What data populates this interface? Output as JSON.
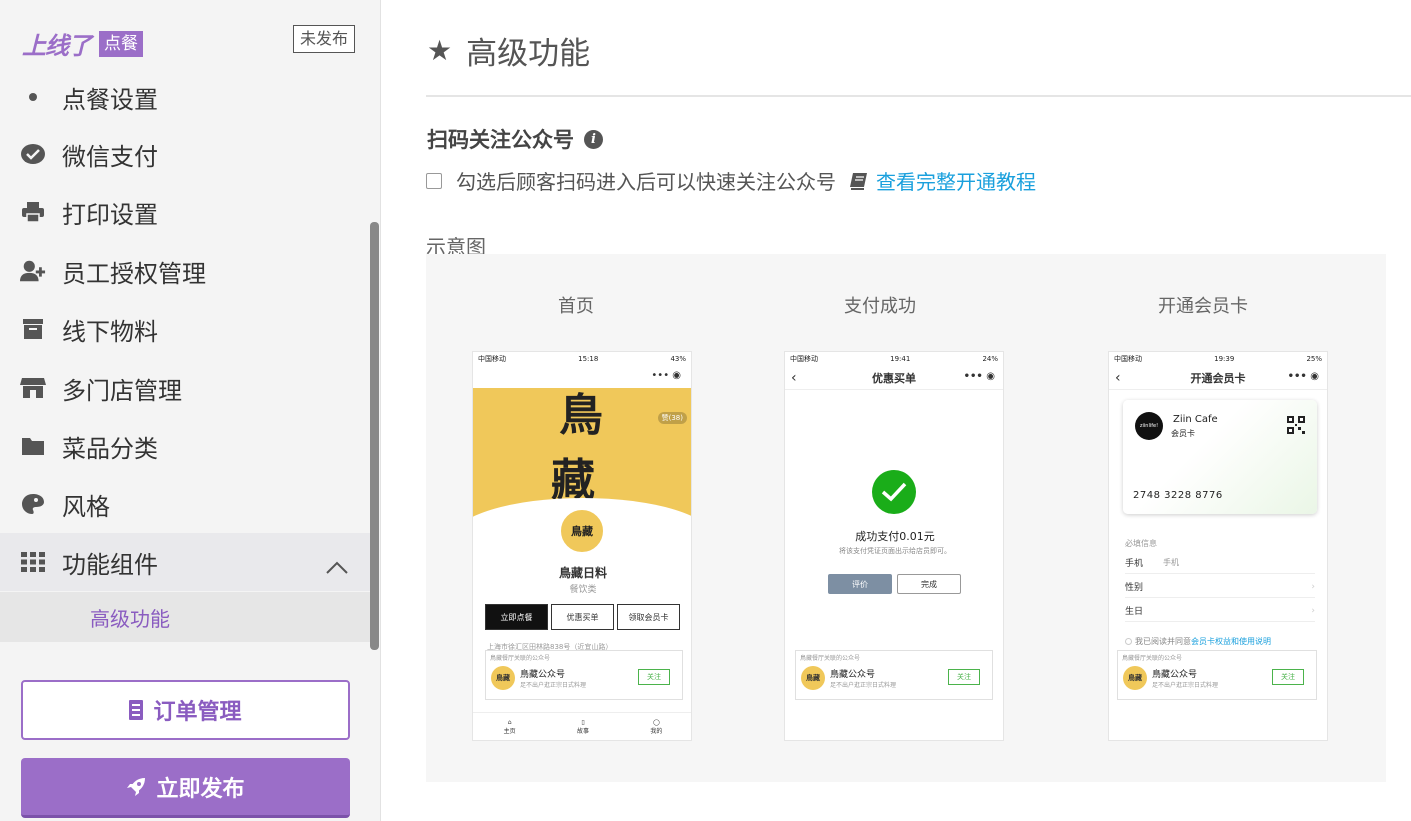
{
  "sidebar": {
    "logo_text": "上线了",
    "logo_badge": "点餐",
    "unpublished": "未发布",
    "partial_item": "点餐设置",
    "items": [
      {
        "label": "微信支付",
        "icon": "wechat-icon"
      },
      {
        "label": "打印设置",
        "icon": "printer-icon"
      },
      {
        "label": "员工授权管理",
        "icon": "user-plus-icon"
      },
      {
        "label": "线下物料",
        "icon": "archive-icon"
      },
      {
        "label": "多门店管理",
        "icon": "store-icon"
      },
      {
        "label": "菜品分类",
        "icon": "folder-icon"
      },
      {
        "label": "风格",
        "icon": "palette-icon"
      },
      {
        "label": "功能组件",
        "icon": "grid-icon"
      }
    ],
    "sub_item": "高级功能",
    "orders_button": "订单管理",
    "publish_button": "立即发布"
  },
  "main": {
    "title": "高级功能",
    "section_title": "扫码关注公众号",
    "checkbox_label": "勾选后顾客扫码进入后可以快速关注公众号",
    "tutorial_link": "查看完整开通教程",
    "demo_label": "示意图",
    "captions": [
      "首页",
      "支付成功",
      "开通会员卡"
    ]
  },
  "phones": {
    "status1": {
      "carrier": "中国移动",
      "time": "15:18",
      "battery": "43%"
    },
    "status2": {
      "carrier": "中国移动",
      "time": "19:41",
      "battery": "24%"
    },
    "status3": {
      "carrier": "中国移动",
      "time": "19:39",
      "battery": "25%"
    },
    "home": {
      "likes": "赞(38)",
      "shop_name": "鳥藏日料",
      "shop_category": "餐饮类",
      "btn_order": "立即点餐",
      "btn_discount": "优惠买单",
      "btn_card": "领取会员卡",
      "address": "上海市徐汇区田林路838号（近宜山路）",
      "tab_home": "主页",
      "tab_story": "故事",
      "tab_mine": "我的"
    },
    "pay": {
      "nav_title": "优惠买单",
      "success_title": "成功支付0.01元",
      "success_sub": "将该支付凭证页面出示给店员即可。",
      "btn_rate": "评价",
      "btn_done": "完成"
    },
    "member": {
      "nav_title": "开通会员卡",
      "cafe_name": "Ziin Cafe",
      "cafe_logo": "ziinlife!",
      "card_sub": "会员卡",
      "card_number": "2748 3228 8776",
      "required": "必填信息",
      "phone_label": "手机",
      "phone_hint": "手机",
      "gender_label": "性别",
      "birthday_label": "生日",
      "agree_text": "我已阅读并同意",
      "agree_link": "会员卡权益和使用说明"
    },
    "follow_card": {
      "header": "鳥藏餐厅关联的公众号",
      "title": "鳥藏公众号",
      "subtitle": "足不出户逛正宗日式料理",
      "button": "关注",
      "avatar_text": "鳥藏"
    }
  },
  "colors": {
    "accent": "#9b6ec8",
    "link": "#1aa0dd",
    "success": "#1aad19"
  }
}
